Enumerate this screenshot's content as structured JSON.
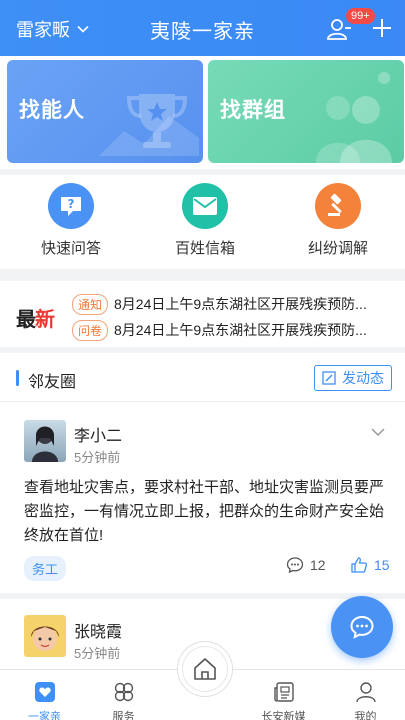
{
  "header": {
    "location": "雷家畈",
    "title": "夷陵一家亲",
    "badge": "99+",
    "accent": "#3e8ff6"
  },
  "cards": [
    {
      "label": "找能人",
      "icon": "trophy-icon"
    },
    {
      "label": "找群组",
      "icon": "group-icon"
    }
  ],
  "quick": [
    {
      "label": "快速问答",
      "icon": "question-icon",
      "color": "#4a93f5"
    },
    {
      "label": "百姓信箱",
      "icon": "mail-icon",
      "color": "#21c1a8"
    },
    {
      "label": "纠纷调解",
      "icon": "gavel-icon",
      "color": "#f4823a"
    }
  ],
  "news": {
    "brand_main": "最",
    "brand_red": "新",
    "items": [
      {
        "tag": "通知",
        "text": "8月24日上午9点东湖社区开展残疾预防..."
      },
      {
        "tag": "问卷",
        "text": "8月24日上午9点东湖社区开展残疾预防..."
      }
    ]
  },
  "circle": {
    "title": "邻友圈",
    "post_label": "发动态"
  },
  "posts": [
    {
      "name": "李小二",
      "time": "5分钟前",
      "content": "查看地址灾害点，要求村社干部、地址灾害监测员要严密监控，一有情况立即上报，把群众的生命财产安全始终放在首位!",
      "category": "务工",
      "comments": "12",
      "likes": "15"
    },
    {
      "name": "张晓霞",
      "time": "5分钟前"
    }
  ],
  "tabs": [
    {
      "label": "一家亲",
      "icon": "heart-chat-icon",
      "active": true
    },
    {
      "label": "服务",
      "icon": "grid-icon",
      "active": false
    },
    {
      "label": "",
      "icon": "home-icon",
      "active": false
    },
    {
      "label": "长安新媒",
      "icon": "news-icon",
      "active": false
    },
    {
      "label": "我的",
      "icon": "user-icon",
      "active": false
    }
  ]
}
